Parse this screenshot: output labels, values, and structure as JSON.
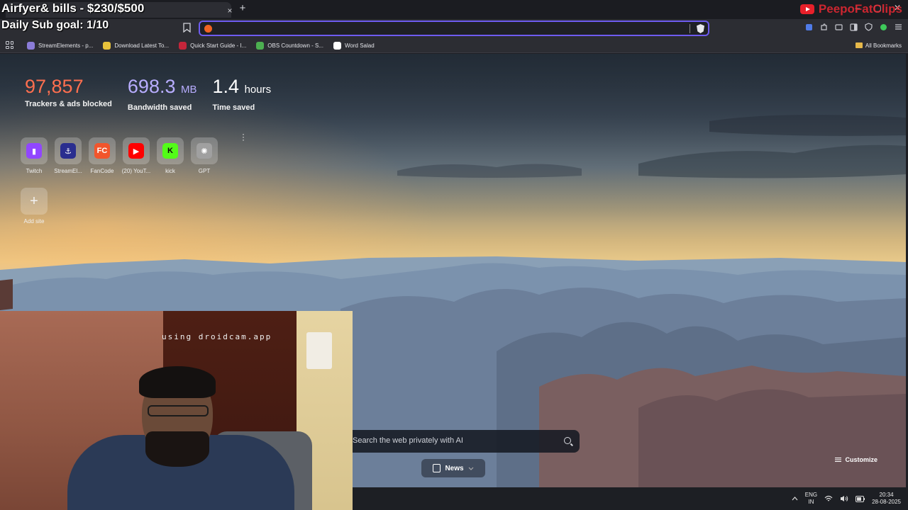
{
  "browser": {
    "new_tab_symbol": "+",
    "tab_close_symbol": "×",
    "window_controls": [
      "–",
      "▢",
      "✕"
    ],
    "url": "",
    "bookmarks": [
      {
        "label": "StreamElements - p...",
        "color": "#8b7cd8"
      },
      {
        "label": "Download Latest To...",
        "color": "#e8c23b"
      },
      {
        "label": "Quick Start Guide - I...",
        "color": "#c4253a"
      },
      {
        "label": "OBS Countdown - S...",
        "color": "#4caf50"
      },
      {
        "label": "Word Salad",
        "color": "#ffffff"
      }
    ],
    "all_bookmarks_label": "All Bookmarks"
  },
  "stats": {
    "trackers": {
      "value": "97,857",
      "unit": "",
      "label": "Trackers & ads blocked"
    },
    "bandwidth": {
      "value": "698.3",
      "unit": "MB",
      "label": "Bandwidth saved"
    },
    "time": {
      "value": "1.4",
      "unit": "hours",
      "label": "Time saved"
    }
  },
  "top_sites": [
    {
      "name": "Twitch",
      "icon": "twitch-icon",
      "color": "#9146ff"
    },
    {
      "name": "StreamEl...",
      "icon": "streamelements-icon",
      "color": "#2a2e8f"
    },
    {
      "name": "FanCode",
      "icon": "fancode-icon",
      "color": "#f2552c"
    },
    {
      "name": "(20) YouT...",
      "icon": "youtube-icon",
      "color": "#ff0000"
    },
    {
      "name": "kick",
      "icon": "kick-icon",
      "color": "#53fc18"
    },
    {
      "name": "GPT",
      "icon": "openai-icon",
      "color": "#a0a0a0"
    }
  ],
  "add_site": {
    "label": "Add site",
    "symbol": "+"
  },
  "search": {
    "placeholder": "Search the web privately with AI"
  },
  "news": {
    "label": "News"
  },
  "customize": {
    "label": "Customize"
  },
  "taskbar": {
    "lang_top": "ENG",
    "lang_bottom": "IN",
    "time": "20:34",
    "date": "28-08-2025"
  },
  "overlay": {
    "goal_text": "Airfyer& bills - $230/$500",
    "sub_goal_text": "Daily Sub goal: 1/10",
    "watermark": "PeepoFatClips",
    "webcam_label": "using droidcam.app"
  }
}
